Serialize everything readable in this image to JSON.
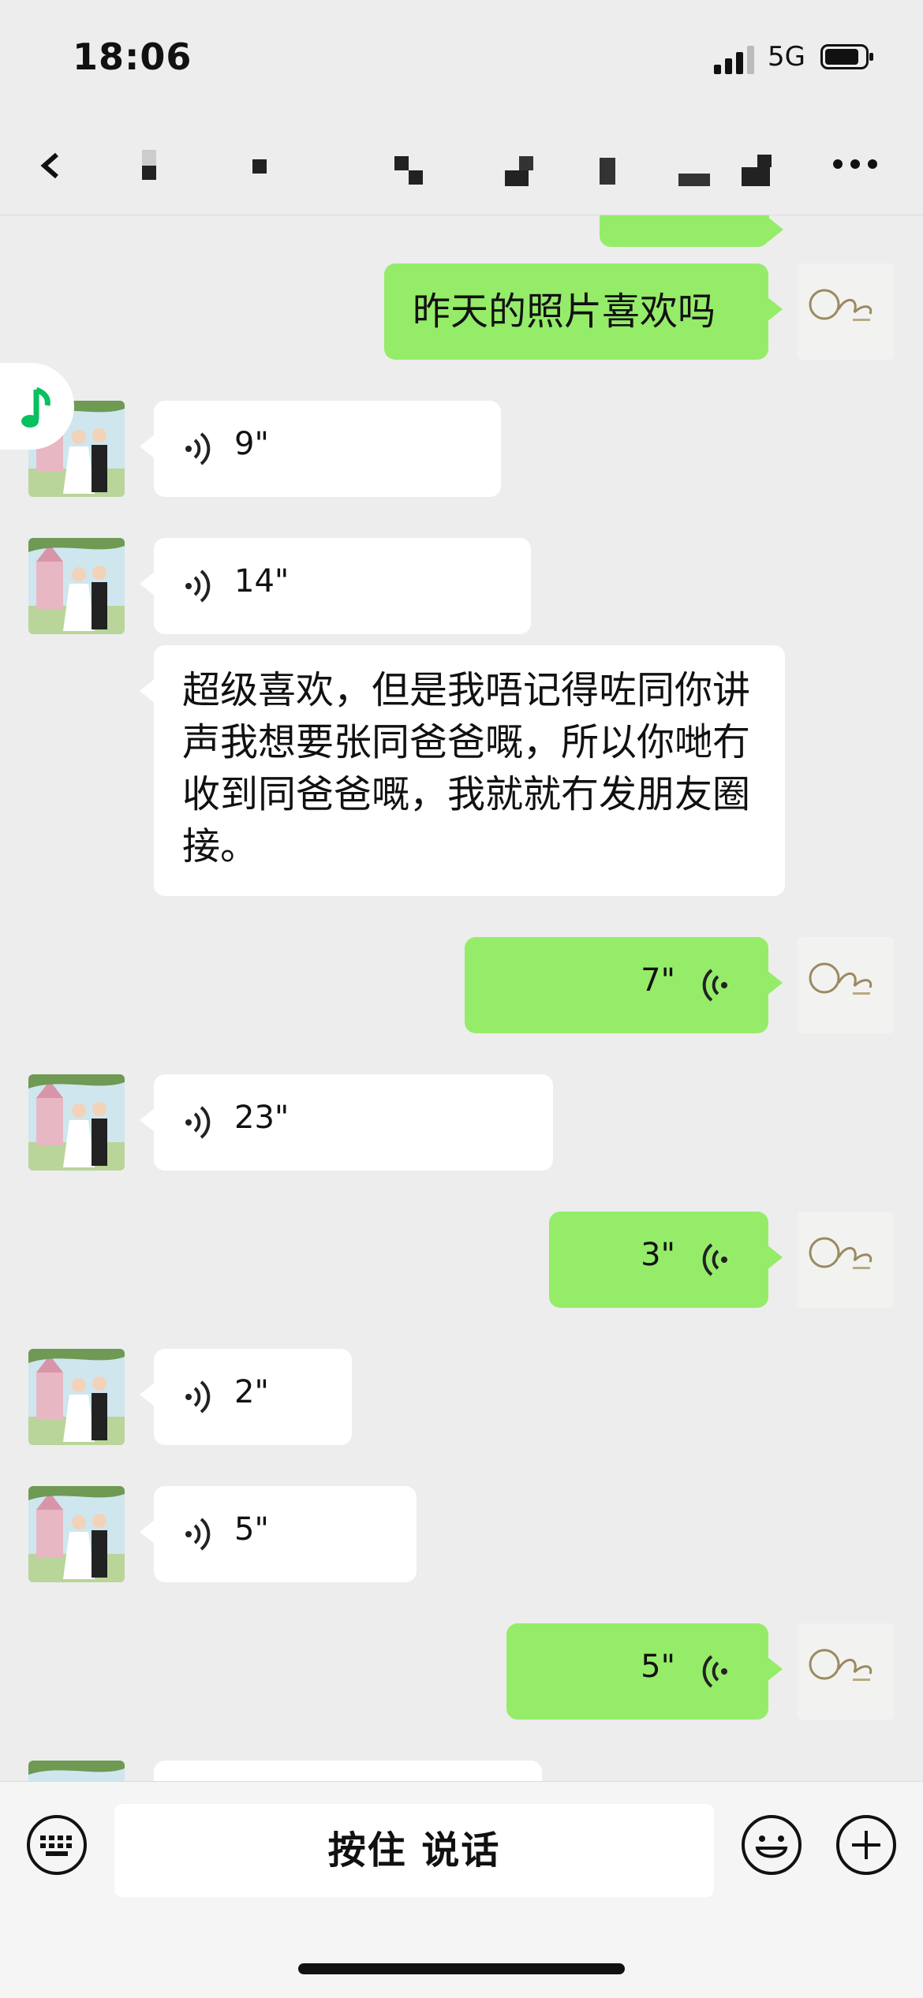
{
  "status": {
    "time": "18:06",
    "network": "5G"
  },
  "nav": {
    "title_obscured": true
  },
  "messages": [
    {
      "side": "out",
      "kind": "text",
      "text": "昨天的照片喜欢吗"
    },
    {
      "side": "in",
      "kind": "voice",
      "duration": "9\""
    },
    {
      "side": "in",
      "kind": "voice",
      "duration": "14\""
    },
    {
      "side": "in",
      "kind": "text",
      "text": "超级喜欢，但是我唔记得咗同你讲声我想要张同爸爸嘅，所以你哋冇收到同爸爸嘅，我就就冇发朋友圈接。"
    },
    {
      "side": "out",
      "kind": "voice",
      "duration": "7\""
    },
    {
      "side": "in",
      "kind": "voice",
      "duration": "23\""
    },
    {
      "side": "out",
      "kind": "voice",
      "duration": "3\""
    },
    {
      "side": "in",
      "kind": "voice",
      "duration": "2\""
    },
    {
      "side": "in",
      "kind": "voice",
      "duration": "5\""
    },
    {
      "side": "out",
      "kind": "voice",
      "duration": "5\""
    }
  ],
  "input": {
    "hold_to_talk": "按住 说话"
  },
  "colors": {
    "outgoing": "#95ec69",
    "incoming": "#ffffff",
    "background": "#ededed",
    "music_icon": "#07c160"
  }
}
